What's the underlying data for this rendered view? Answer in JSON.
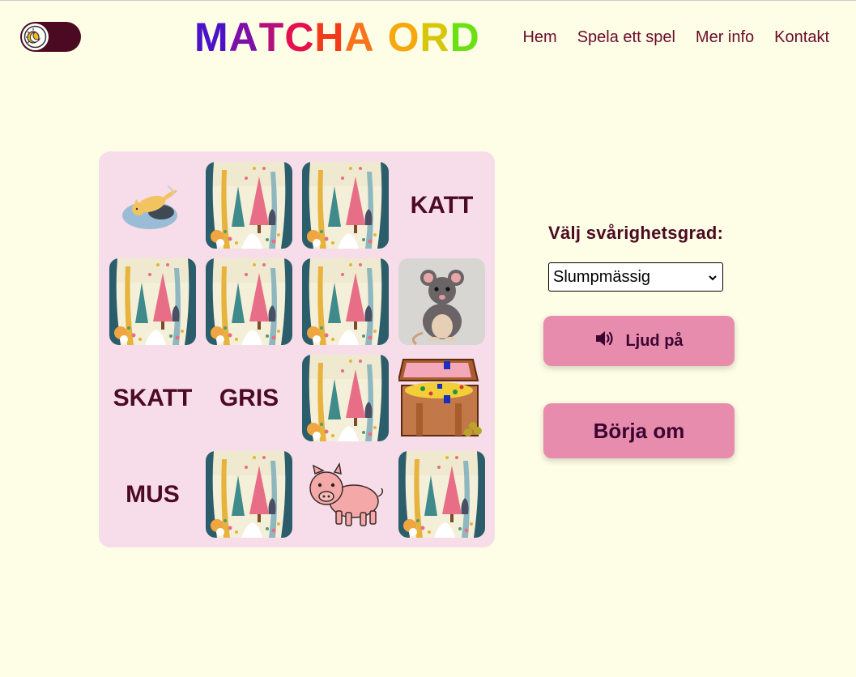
{
  "header": {
    "logo_letters": [
      {
        "ch": "M",
        "color": "#4b12c8"
      },
      {
        "ch": "A",
        "color": "#7d10a8"
      },
      {
        "ch": "T",
        "color": "#b3107c"
      },
      {
        "ch": "C",
        "color": "#e41050"
      },
      {
        "ch": "H",
        "color": "#f23a1c"
      },
      {
        "ch": "A",
        "color": "#f7741a"
      },
      {
        "ch": " ",
        "color": "#000000"
      },
      {
        "ch": "O",
        "color": "#f6a80d"
      },
      {
        "ch": "R",
        "color": "#d6c70a"
      },
      {
        "ch": "D",
        "color": "#6be013"
      }
    ],
    "nav": [
      "Hem",
      "Spela ett spel",
      "Mer info",
      "Kontakt"
    ],
    "theme_toggle_icon": "sun-moon-icon"
  },
  "board": {
    "cards": [
      {
        "type": "picture",
        "icon": "cat-icon"
      },
      {
        "type": "back"
      },
      {
        "type": "back"
      },
      {
        "type": "word",
        "text": "KATT"
      },
      {
        "type": "back"
      },
      {
        "type": "back"
      },
      {
        "type": "back"
      },
      {
        "type": "picture",
        "icon": "mouse-icon"
      },
      {
        "type": "word",
        "text": "SKATT"
      },
      {
        "type": "word",
        "text": "GRIS"
      },
      {
        "type": "back"
      },
      {
        "type": "picture",
        "icon": "treasure-chest-icon"
      },
      {
        "type": "word",
        "text": "MUS"
      },
      {
        "type": "back"
      },
      {
        "type": "picture",
        "icon": "pig-icon"
      },
      {
        "type": "back"
      }
    ]
  },
  "controls": {
    "difficulty_label": "Välj svårighetsgrad:",
    "difficulty_selected": "Slumpmässig",
    "sound_label": "Ljud på",
    "sound_icon": "speaker-icon",
    "restart_label": "Börja om"
  },
  "colors": {
    "background": "#fefee6",
    "board": "#f7dde9",
    "button": "#e88cae",
    "text_dark": "#4b0a22"
  }
}
